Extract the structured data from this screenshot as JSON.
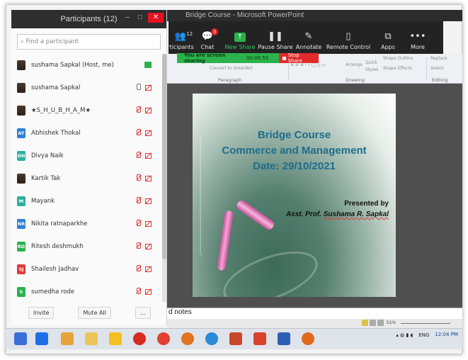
{
  "participants": {
    "header_title": "Participants (12)",
    "search_placeholder": "Find a participant",
    "list": [
      {
        "name": "sushama Sapkal (Host, me)",
        "avatar": "",
        "color": "photo"
      },
      {
        "name": "sushama Sapkal",
        "avatar": "",
        "color": "photo"
      },
      {
        "name": "★S_H_U_B_H_A_M★",
        "avatar": "",
        "color": "photo"
      },
      {
        "name": "Abhishek Thokal",
        "avatar": "AT",
        "color": "#2f7fd6"
      },
      {
        "name": "Divya Naik",
        "avatar": "DN",
        "color": "#2bb0a0"
      },
      {
        "name": "Kartik Tak",
        "avatar": "",
        "color": "photo"
      },
      {
        "name": "Mayank",
        "avatar": "M",
        "color": "#2bb0a0"
      },
      {
        "name": "Nikita ratnaparkhe",
        "avatar": "NR",
        "color": "#2f7fd6"
      },
      {
        "name": "Ritesh deshmukh",
        "avatar": "RD",
        "color": "#2bb24c"
      },
      {
        "name": "Shailesh Jadhav",
        "avatar": "SJ",
        "color": "#e03a3a"
      },
      {
        "name": "sumedha rode",
        "avatar": "S",
        "color": "#2bb24c"
      }
    ],
    "invite_label": "Invite",
    "mute_all_label": "Mute All",
    "more_label": "..."
  },
  "powerpoint": {
    "title": "Bridge Course - Microsoft PowerPoint",
    "ribbon_groups": {
      "paragraph": "Paragraph",
      "drawing": "Drawing",
      "editing": "Editing"
    },
    "ribbon_items": {
      "convert": "Convert to SmartArt",
      "arrange": "Arrange",
      "quick": "Quick",
      "styles": "Styles",
      "shape_outline": "Shape Outline",
      "shape_effects": "Shape Effects",
      "replace": "Replace",
      "select": "Select"
    },
    "notes_text": "d notes",
    "zoom_percent": "51%"
  },
  "zoom_toolbar": {
    "participants_count": "12",
    "participants_label": "rticipants",
    "chat_label": "Chat",
    "chat_badge": "3",
    "new_share_label": "New Share",
    "pause_share_label": "Pause Share",
    "annotate_label": "Annotate",
    "remote_control_label": "Remote Control",
    "apps_label": "Apps",
    "more_label": "More"
  },
  "share_bar": {
    "message": "You are screen sharing",
    "timer": "00:06:55",
    "stop_label": "Stop Share"
  },
  "slide": {
    "line1": "Bridge Course",
    "line2": "Commerce and Management",
    "line3": "Date: 29/10/2021",
    "presented_by": "Presented by",
    "presenter_prefix": "Asst. Prof. ",
    "presenter_name": "Sushama R. Sapkal"
  },
  "taskbar": {
    "language": "ENG",
    "time": "12:04 PM"
  }
}
